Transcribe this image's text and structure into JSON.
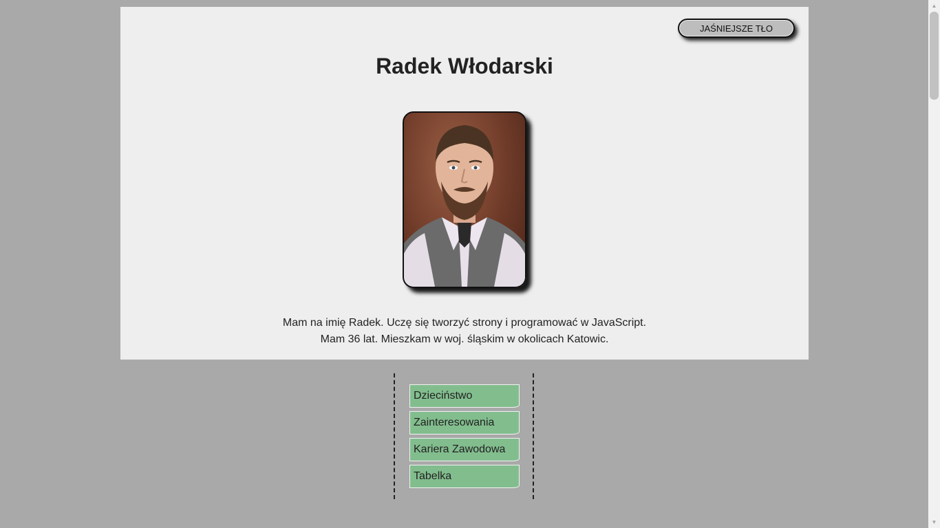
{
  "header": {
    "toggle_label": "JAŚNIEJSZE TŁO",
    "title": "Radek Włodarski"
  },
  "portrait": {
    "alt": "Radek Włodarski"
  },
  "bio": {
    "line1": "Mam na imię Radek. Uczę się tworzyć strony i programować w JavaScript.",
    "line2": "Mam 36 lat. Mieszkam w woj. śląskim w okolicach Katowic."
  },
  "nav": {
    "items": [
      {
        "label": "Dzieciństwo"
      },
      {
        "label": "Zainteresowania"
      },
      {
        "label": "Kariera Zawodowa"
      },
      {
        "label": "Tabelka"
      }
    ]
  },
  "colors": {
    "page_background": "#a9a9a9",
    "card_background": "#eeeeee",
    "nav_item_background": "#82bd8e"
  }
}
